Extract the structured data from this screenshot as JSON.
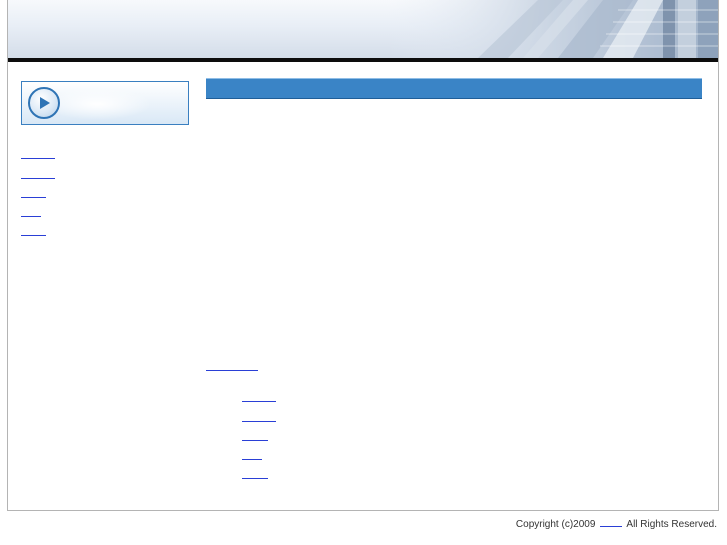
{
  "header": {
    "banner_icon": "building-facade-image"
  },
  "sidebar": {
    "banner_icon": "play-icon",
    "links": [
      "",
      "",
      "",
      "",
      ""
    ]
  },
  "main": {
    "bar_color": "#3a84c6",
    "section_link": "",
    "sub_links": [
      "",
      "",
      "",
      "",
      ""
    ]
  },
  "footer": {
    "copyright_prefix": "Copyright (c)2009",
    "company_link": "",
    "rights_suffix": "All Rights Reserved."
  },
  "colors": {
    "accent": "#3a84c6",
    "link": "#2a3fd6",
    "header_bar": "#0d0d0d"
  }
}
